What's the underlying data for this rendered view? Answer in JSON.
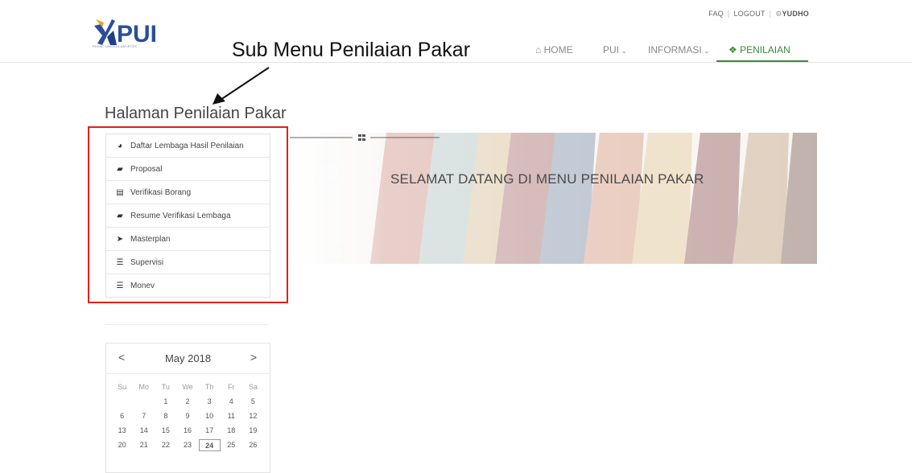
{
  "util": {
    "faq": "FAQ",
    "logout": "LOGOUT",
    "user": "YUDHO"
  },
  "logo": {
    "text": "PUI",
    "tagline": "PUSAT UNGGULAN IPTEK"
  },
  "annotation": "Sub Menu Penilaian Pakar",
  "nav": {
    "home": "HOME",
    "pui": "PUI",
    "informasi": "INFORMASI",
    "penilaian": "PENILAIAN"
  },
  "page_title": "Halaman Penilaian Pakar",
  "menu": [
    {
      "label": "Daftar Lembaga Hasil Penilaian",
      "icon": "pie-chart-icon"
    },
    {
      "label": "Proposal",
      "icon": "book-icon"
    },
    {
      "label": "Verifikasi Borang",
      "icon": "file-icon"
    },
    {
      "label": "Resume Verifikasi Lembaga",
      "icon": "book-icon"
    },
    {
      "label": "Masterplan",
      "icon": "paper-plane-icon"
    },
    {
      "label": "Supervisi",
      "icon": "list-icon"
    },
    {
      "label": "Monev",
      "icon": "list-icon"
    }
  ],
  "banner": {
    "title": "SELAMAT DATANG DI MENU PENILAIAN PAKAR"
  },
  "calendar": {
    "prev": "<",
    "next": ">",
    "title": "May 2018",
    "dow": [
      "Su",
      "Mo",
      "Tu",
      "We",
      "Th",
      "Fr",
      "Sa"
    ],
    "weeks": [
      [
        "",
        "",
        "1",
        "2",
        "3",
        "4",
        "5"
      ],
      [
        "6",
        "7",
        "8",
        "9",
        "10",
        "11",
        "12"
      ],
      [
        "13",
        "14",
        "15",
        "16",
        "17",
        "18",
        "19"
      ],
      [
        "20",
        "21",
        "22",
        "23",
        "24",
        "25",
        "26"
      ]
    ],
    "today": "24"
  },
  "colors": {
    "accent_green": "#3a8a3a",
    "highlight_red": "#e0201c"
  }
}
